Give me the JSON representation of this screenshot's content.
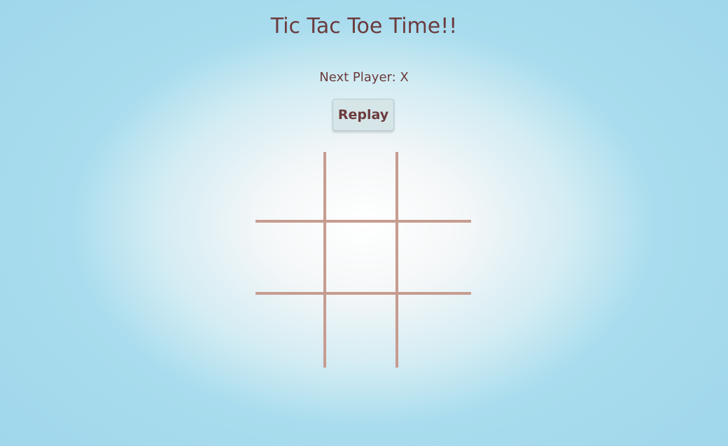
{
  "game": {
    "title": "Tic Tac Toe Time!!",
    "status": "Next Player: X",
    "replay_label": "Replay"
  },
  "board": {
    "cells": [
      "",
      "",
      "",
      "",
      "",
      "",
      "",
      "",
      ""
    ]
  },
  "colors": {
    "text": "#6b3b3d",
    "grid_line": "#c69c90",
    "button_bg": "#d5e5e8",
    "background_center": "#ffffff",
    "background_edge": "#a9ddee"
  }
}
